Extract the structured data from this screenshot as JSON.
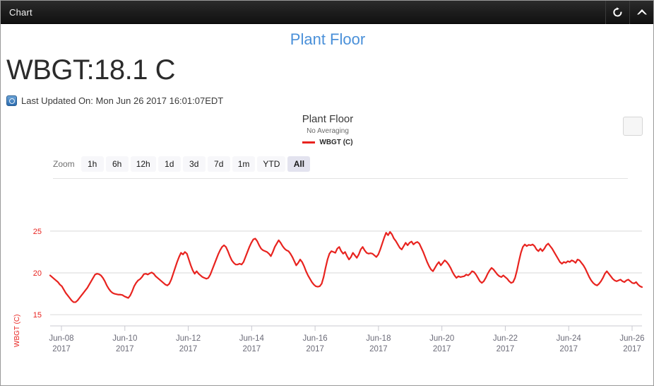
{
  "window": {
    "title": "Chart",
    "buttons": [
      {
        "name": "refresh-button",
        "icon": "refresh-icon",
        "label": "Refresh"
      },
      {
        "name": "collapse-button",
        "icon": "chevron-up-icon",
        "label": "Collapse"
      }
    ]
  },
  "header": {
    "page_link": "Plant Floor",
    "reading_label": "WBGT:",
    "reading_value": "18.1 C",
    "reading_full": "WBGT:18.1 C",
    "last_updated": "Last Updated On: Mon Jun 26 2017 16:01:07EDT",
    "status_icon": "clock-icon"
  },
  "chart": {
    "title": "Plant Floor",
    "subtitle": "No Averaging",
    "legend_label": "WBGT (C)",
    "series_color": "#e8231f",
    "menu_button_label": "",
    "zoom_label": "Zoom",
    "zoom_options": [
      "1h",
      "6h",
      "12h",
      "1d",
      "3d",
      "7d",
      "1m",
      "YTD",
      "All"
    ],
    "zoom_selected": "All"
  },
  "chart_data": {
    "type": "line",
    "title": "Plant Floor",
    "subtitle": "No Averaging",
    "xlabel": "",
    "ylabel": "WBGT (C)",
    "ylim": [
      14.0,
      26.0
    ],
    "yticks": [
      15,
      20,
      25
    ],
    "ytick_labels": [
      "15",
      "20",
      "25"
    ],
    "xticks": [
      "Jun-08\n2017",
      "Jun-10\n2017",
      "Jun-12\n2017",
      "Jun-14\n2017",
      "Jun-16\n2017",
      "Jun-18\n2017",
      "Jun-20\n2017",
      "Jun-22\n2017",
      "Jun-24\n2017",
      "Jun-26\n2017"
    ],
    "xtick_dates": [
      "Jun-08",
      "Jun-10",
      "Jun-12",
      "Jun-14",
      "Jun-16",
      "Jun-18",
      "Jun-20",
      "Jun-22",
      "Jun-24",
      "Jun-26"
    ],
    "xtick_year": "2017",
    "xlim": [
      "2017-06-07T12:00",
      "2017-06-26T16:00"
    ],
    "grid": true,
    "grid_axis": "y",
    "legend": {
      "position": "top-center",
      "entries": [
        "WBGT (C)"
      ]
    },
    "series": [
      {
        "name": "WBGT (C)",
        "color": "#e8231f",
        "units": "C",
        "x_start": "2017-06-07T12:00",
        "x_end": "2017-06-26T16:00",
        "sample_interval_hours": 0.55,
        "values": [
          19.7,
          19.5,
          19.3,
          19.1,
          18.9,
          18.6,
          18.4,
          18.0,
          17.6,
          17.3,
          17.0,
          16.7,
          16.5,
          16.5,
          16.7,
          17.0,
          17.3,
          17.6,
          17.9,
          18.2,
          18.6,
          19.0,
          19.4,
          19.8,
          19.9,
          19.85,
          19.7,
          19.4,
          19.0,
          18.5,
          18.1,
          17.8,
          17.6,
          17.5,
          17.45,
          17.4,
          17.4,
          17.35,
          17.2,
          17.1,
          17.0,
          17.3,
          17.8,
          18.4,
          18.8,
          19.1,
          19.25,
          19.5,
          19.85,
          19.9,
          19.8,
          19.95,
          20.05,
          19.9,
          19.6,
          19.4,
          19.2,
          19.0,
          18.8,
          18.6,
          18.5,
          18.7,
          19.2,
          19.9,
          20.6,
          21.3,
          21.9,
          22.4,
          22.2,
          22.5,
          22.3,
          21.6,
          20.9,
          20.3,
          19.9,
          20.2,
          19.9,
          19.7,
          19.5,
          19.4,
          19.3,
          19.4,
          19.8,
          20.4,
          21.0,
          21.6,
          22.2,
          22.7,
          23.1,
          23.3,
          23.1,
          22.6,
          22.0,
          21.5,
          21.2,
          21.0,
          21.0,
          21.1,
          21.0,
          21.3,
          21.9,
          22.5,
          23.1,
          23.6,
          24.0,
          24.1,
          23.8,
          23.3,
          22.9,
          22.7,
          22.6,
          22.5,
          22.3,
          22.0,
          22.5,
          23.1,
          23.5,
          23.9,
          23.6,
          23.2,
          22.9,
          22.7,
          22.6,
          22.3,
          21.9,
          21.4,
          20.9,
          21.2,
          21.6,
          21.3,
          20.8,
          20.2,
          19.7,
          19.3,
          18.9,
          18.6,
          18.4,
          18.35,
          18.4,
          18.7,
          19.5,
          20.6,
          21.6,
          22.3,
          22.6,
          22.5,
          22.4,
          22.9,
          23.1,
          22.6,
          22.3,
          22.5,
          22.0,
          21.6,
          21.9,
          22.4,
          22.1,
          21.8,
          22.2,
          22.8,
          23.1,
          22.7,
          22.4,
          22.3,
          22.35,
          22.3,
          22.1,
          21.9,
          22.2,
          22.8,
          23.5,
          24.2,
          24.8,
          24.5,
          24.9,
          24.6,
          24.1,
          23.8,
          23.4,
          23.0,
          22.8,
          23.2,
          23.6,
          23.3,
          23.6,
          23.75,
          23.4,
          23.6,
          23.7,
          23.5,
          23.0,
          22.5,
          21.9,
          21.3,
          20.8,
          20.4,
          20.2,
          20.6,
          21.0,
          21.3,
          20.9,
          21.2,
          21.5,
          21.3,
          21.0,
          20.6,
          20.1,
          19.7,
          19.4,
          19.6,
          19.5,
          19.55,
          19.6,
          19.8,
          19.7,
          19.9,
          20.2,
          20.1,
          19.8,
          19.4,
          19.0,
          18.8,
          19.0,
          19.4,
          19.9,
          20.3,
          20.6,
          20.4,
          20.1,
          19.8,
          19.6,
          19.5,
          19.7,
          19.5,
          19.3,
          19.0,
          18.8,
          18.9,
          19.4,
          20.3,
          21.4,
          22.4,
          23.1,
          23.4,
          23.2,
          23.35,
          23.3,
          23.4,
          23.2,
          22.8,
          22.6,
          22.9,
          22.6,
          22.9,
          23.3,
          23.5,
          23.2,
          22.9,
          22.5,
          22.1,
          21.7,
          21.3,
          21.1,
          21.3,
          21.2,
          21.4,
          21.3,
          21.5,
          21.4,
          21.2,
          21.6,
          21.5,
          21.2,
          20.9,
          20.5,
          20.0,
          19.5,
          19.1,
          18.8,
          18.6,
          18.5,
          18.7,
          19.0,
          19.4,
          19.9,
          20.2,
          19.9,
          19.6,
          19.3,
          19.1,
          19.0,
          19.1,
          19.2,
          19.0,
          18.9,
          19.1,
          19.2,
          19.0,
          18.8,
          18.75,
          18.9,
          18.6,
          18.4,
          18.3
        ]
      }
    ]
  }
}
